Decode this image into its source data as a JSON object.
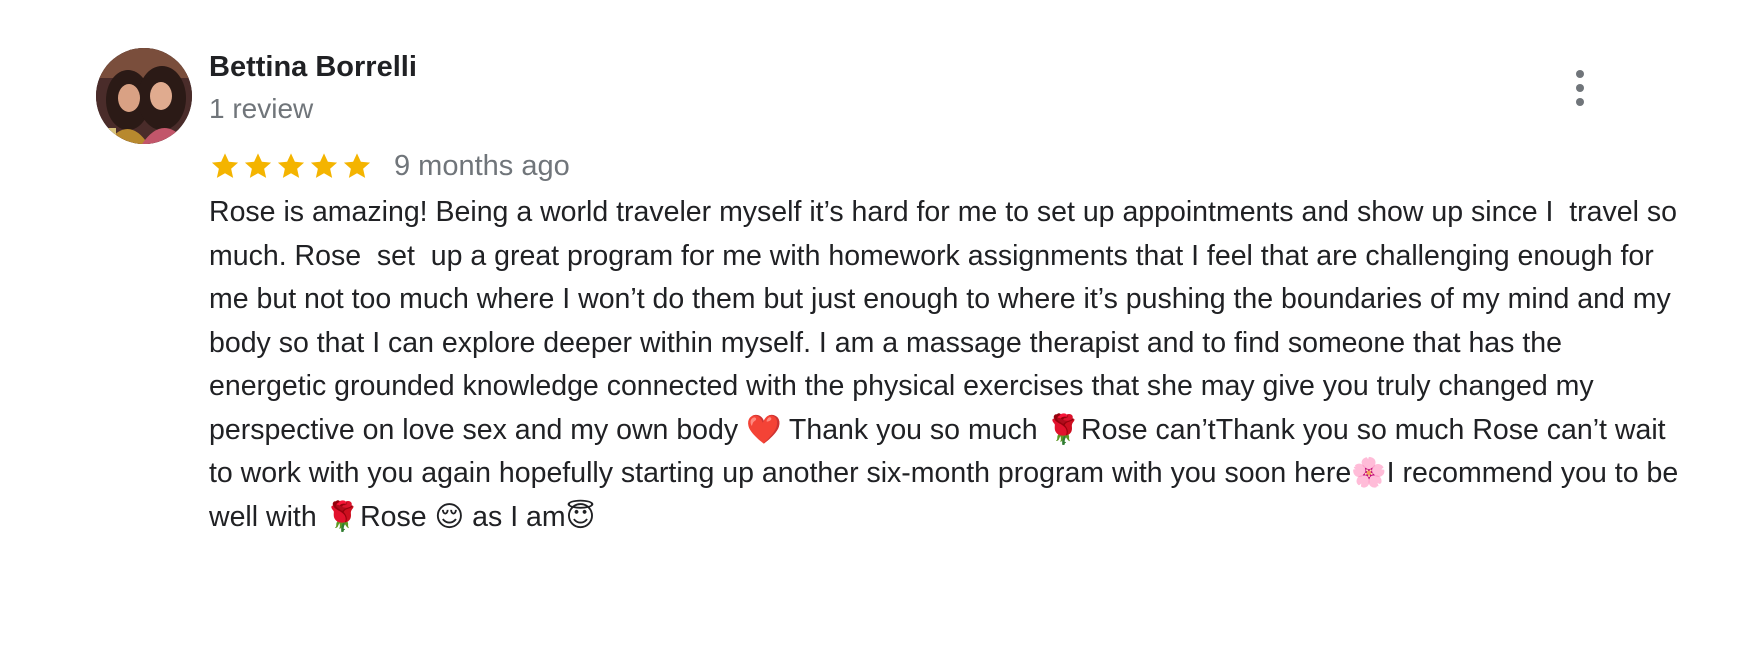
{
  "review": {
    "reviewer_name": "Bettina Borrelli",
    "review_count": "1 review",
    "rating": 5,
    "rating_max": 5,
    "date": "9 months ago",
    "text": "Rose is amazing! Being a world traveler myself it’s hard for me to set up appointments and show up since I  travel so much. Rose  set  up a great program for me with homework assignments that I feel that are challenging enough for me but not too much where I won’t do them but just enough to where it’s pushing the boundaries of my mind and my body so that I can explore deeper within myself. I am a massage therapist and to find someone that has the energetic grounded knowledge connected with the physical exercises that she may give you truly changed my perspective on love sex and my own body ❤️ Thank you so much 🌹Rose can’tThank you so much Rose can’t wait to work with you again hopefully starting up another six-month program with you soon here🌸I recommend you to be well with 🌹Rose 😌 as I am😇"
  },
  "icons": {
    "avatar": "avatar-photo",
    "star": "star-icon",
    "more": "more-vert-icon"
  },
  "colors": {
    "star": "#f4b400",
    "name": "#202124",
    "secondary_text": "#70757a"
  }
}
